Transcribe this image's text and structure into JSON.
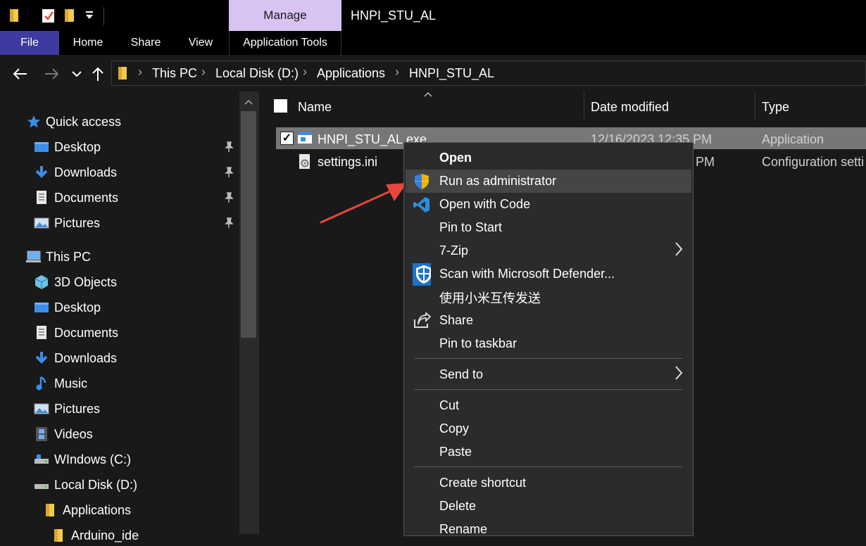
{
  "window": {
    "title": "HNPI_STU_AL"
  },
  "ribbon": {
    "context_tab": "Manage",
    "tabs": [
      "File",
      "Home",
      "Share",
      "View",
      "Application Tools"
    ]
  },
  "address": {
    "back": "←",
    "forward": "→",
    "recent": "⌄",
    "up": "↑",
    "crumbs": [
      "This PC",
      "Local Disk (D:)",
      "Applications",
      "HNPI_STU_AL"
    ],
    "separator": "›"
  },
  "nav": {
    "quick_access": "Quick access",
    "quick_items": [
      "Desktop",
      "Downloads",
      "Documents",
      "Pictures"
    ],
    "this_pc": "This PC",
    "pc_items": [
      "3D Objects",
      "Desktop",
      "Documents",
      "Downloads",
      "Music",
      "Pictures",
      "Videos",
      "WIndows (C:)",
      "Local Disk (D:)"
    ],
    "applications": "Applications",
    "arduino": "Arduino_ide"
  },
  "columns": {
    "name": "Name",
    "date": "Date modified",
    "type": "Type"
  },
  "files": [
    {
      "name": "HNPI_STU_AL.exe",
      "date": "12/16/2023 12:35 PM",
      "type": "Application",
      "selected": true
    },
    {
      "name": "settings.ini",
      "date": "PM",
      "type": "Configuration setti",
      "selected": false
    }
  ],
  "context_menu": {
    "open": "Open",
    "run_admin": "Run as administrator",
    "open_code": "Open with Code",
    "pin_start": "Pin to Start",
    "seven_zip": "7-Zip",
    "scan": "Scan with Microsoft Defender...",
    "xiaomi": "使用小米互传发送",
    "share": "Share",
    "pin_taskbar": "Pin to taskbar",
    "send_to": "Send to",
    "cut": "Cut",
    "copy": "Copy",
    "paste": "Paste",
    "create_shortcut": "Create shortcut",
    "delete": "Delete",
    "rename": "Rename"
  },
  "icons": {
    "submenu_arrow": "chevron-right-icon",
    "pin": "pin-icon"
  },
  "colors": {
    "manage_tab": "#d9c3f2",
    "file_tab": "#3f3aa0",
    "selection": "#777777",
    "menu_bg": "#2b2b2b",
    "arrow": "#e8453c"
  }
}
